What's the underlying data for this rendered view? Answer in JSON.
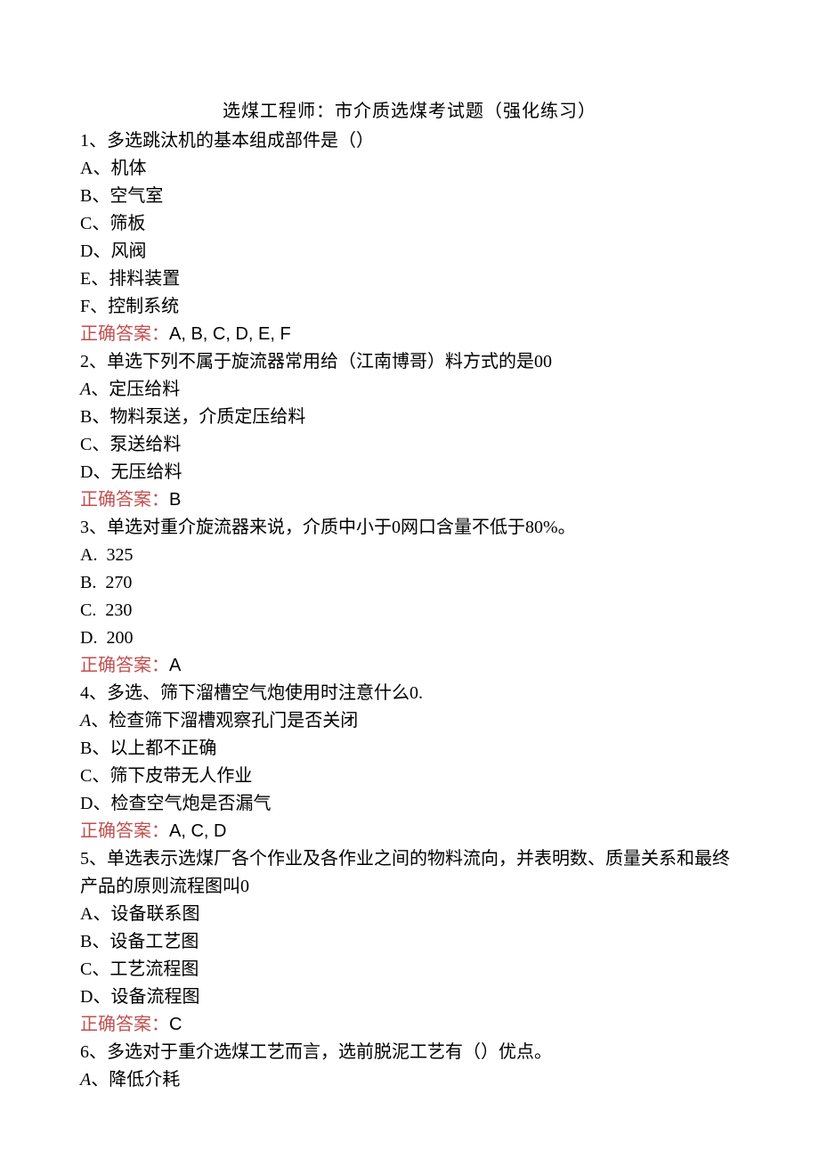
{
  "title": "选煤工程师：市介质选煤考试题（强化练习）",
  "q1": {
    "stem": "1、多选跳汰机的基本组成部件是（）",
    "A": "A、机体",
    "B": "B、空气室",
    "C": "C、筛板",
    "D": "D、风阀",
    "E": "E、排料装置",
    "F": "F、控制系统",
    "ans_label": "正确答案：",
    "ans_value": "A, B, C, D, E, F"
  },
  "q2": {
    "stem": "2、单选下列不属于旋流器常用给（江南博哥）料方式的是00",
    "A_pre": "A",
    "A_post": "、定压给料",
    "B": "B、物料泵送，介质定压给料",
    "C": "C、泵送给料",
    "D": "D、无压给料",
    "ans_label": "正确答案：",
    "ans_value": "B"
  },
  "q3": {
    "stem": "3、单选对重介旋流器来说，介质中小于0网口含量不低于80%。",
    "A": "A.  325",
    "B": "B.  270",
    "C": "C.  230",
    "D": "D.  200",
    "ans_label": "正确答案：",
    "ans_value": "A"
  },
  "q4": {
    "stem": "4、多选、筛下溜槽空气炮使用时注意什么0.",
    "A_pre": "A",
    "A_post": "、检查筛下溜槽观察孔门是否关闭",
    "B": "B、以上都不正确",
    "C": "C、筛下皮带无人作业",
    "D": "D、检查空气炮是否漏气",
    "ans_label": "正确答案：",
    "ans_value": "A, C, D"
  },
  "q5": {
    "stem": "5、单选表示选煤厂各个作业及各作业之间的物料流向，并表明数、质量关系和最终产品的原则流程图叫0",
    "A": "A、设备联系图",
    "B": "B、设备工艺图",
    "C": "C、工艺流程图",
    "D": "D、设备流程图",
    "ans_label": "正确答案：",
    "ans_value": "C"
  },
  "q6": {
    "stem": "6、多选对于重介选煤工艺而言，选前脱泥工艺有（）优点。",
    "A_pre": "A",
    "A_post": "、降低介耗"
  }
}
